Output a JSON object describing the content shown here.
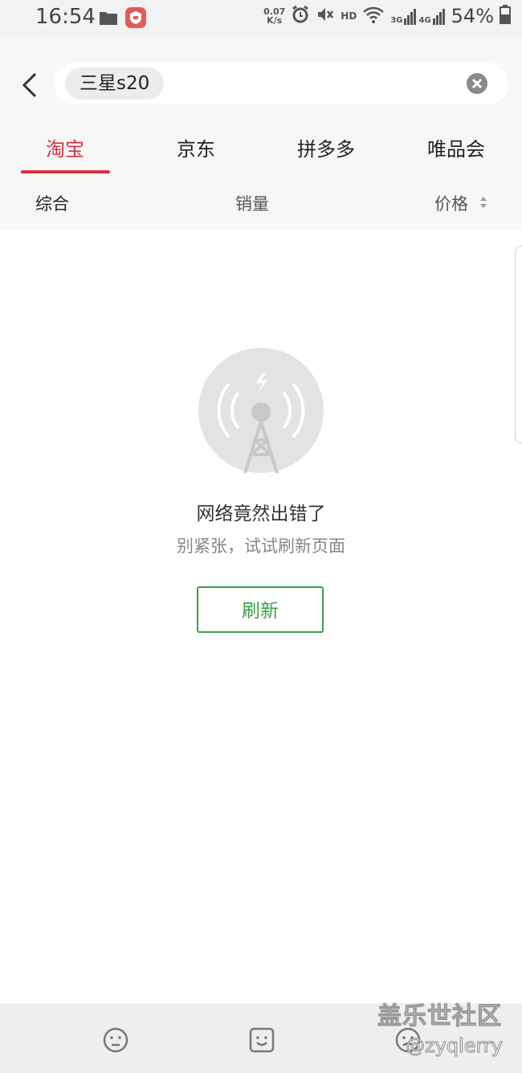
{
  "status_bar": {
    "time": "16:54",
    "net_speed_value": "0.07",
    "net_speed_unit": "K/s",
    "hd_label": "HD",
    "signal_3g": "3G",
    "signal_4g": "4G",
    "battery": "54%",
    "icons": [
      "folder-icon",
      "shield-app-icon",
      "alarm-icon",
      "mute-icon",
      "wifi-icon",
      "signal-icon",
      "battery-icon"
    ]
  },
  "search": {
    "query": "三星s20"
  },
  "tabs": [
    {
      "label": "淘宝",
      "active": true
    },
    {
      "label": "京东",
      "active": false
    },
    {
      "label": "拼多多",
      "active": false
    },
    {
      "label": "唯品会",
      "active": false
    }
  ],
  "sort": {
    "overall": "综合",
    "sales": "销量",
    "price": "价格"
  },
  "error": {
    "title": "网络竟然出错了",
    "subtitle": "别紧张，试试刷新页面",
    "refresh_label": "刷新"
  },
  "bottom_bar": {
    "icons": [
      "confused-face-icon",
      "smile-face-icon",
      "sad-face-icon"
    ]
  },
  "watermark": {
    "title": "盖乐世社区",
    "handle": "@zyqlerry"
  },
  "colors": {
    "accent_red": "#d6303f",
    "refresh_green": "#3aa04a",
    "header_bg": "#f7f7f7"
  }
}
